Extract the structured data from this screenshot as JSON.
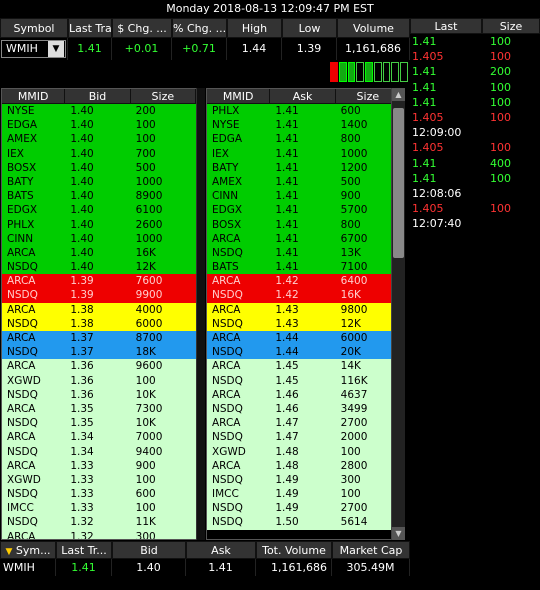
{
  "header": {
    "datetime": "Monday 2018-08-13 12:09:47 PM EST"
  },
  "quote_columns": [
    "Symbol",
    "Last Tra...",
    "$ Chg. ...",
    "% Chg. ...",
    "High",
    "Low",
    "Volume"
  ],
  "quote": {
    "symbol": "WMIH",
    "last": "1.41",
    "chg": "+0.01",
    "pct": "+0.71",
    "high": "1.44",
    "low": "1.39",
    "volume": "1,161,686"
  },
  "meter": [
    "red",
    "green",
    "green",
    "empty",
    "green",
    "empty",
    "empty",
    "empty",
    "empty"
  ],
  "bid_columns": [
    "MMID",
    "Bid",
    "Size"
  ],
  "ask_columns": [
    "MMID",
    "Ask",
    "Size"
  ],
  "bids": [
    [
      "NYSE",
      "1.40",
      "200",
      0
    ],
    [
      "EDGA",
      "1.40",
      "100",
      0
    ],
    [
      "AMEX",
      "1.40",
      "100",
      0
    ],
    [
      "IEX",
      "1.40",
      "700",
      0
    ],
    [
      "BOSX",
      "1.40",
      "500",
      0
    ],
    [
      "BATY",
      "1.40",
      "1000",
      0
    ],
    [
      "BATS",
      "1.40",
      "8900",
      0
    ],
    [
      "EDGX",
      "1.40",
      "6100",
      0
    ],
    [
      "PHLX",
      "1.40",
      "2600",
      0
    ],
    [
      "CINN",
      "1.40",
      "1000",
      0
    ],
    [
      "ARCA",
      "1.40",
      "16K",
      0
    ],
    [
      "NSDQ",
      "1.40",
      "12K",
      0
    ],
    [
      "ARCA",
      "1.39",
      "7600",
      1
    ],
    [
      "NSDQ",
      "1.39",
      "9900",
      1
    ],
    [
      "ARCA",
      "1.38",
      "4000",
      2
    ],
    [
      "NSDQ",
      "1.38",
      "6000",
      2
    ],
    [
      "ARCA",
      "1.37",
      "8700",
      3
    ],
    [
      "NSDQ",
      "1.37",
      "18K",
      3
    ],
    [
      "ARCA",
      "1.36",
      "9600",
      4
    ],
    [
      "XGWD",
      "1.36",
      "100",
      4
    ],
    [
      "NSDQ",
      "1.36",
      "10K",
      4
    ],
    [
      "ARCA",
      "1.35",
      "7300",
      4
    ],
    [
      "NSDQ",
      "1.35",
      "10K",
      4
    ],
    [
      "ARCA",
      "1.34",
      "7000",
      4
    ],
    [
      "NSDQ",
      "1.34",
      "9400",
      4
    ],
    [
      "ARCA",
      "1.33",
      "900",
      4
    ],
    [
      "XGWD",
      "1.33",
      "100",
      4
    ],
    [
      "NSDQ",
      "1.33",
      "600",
      4
    ],
    [
      "IMCC",
      "1.33",
      "100",
      4
    ],
    [
      "NSDQ",
      "1.32",
      "11K",
      4
    ],
    [
      "ARCA",
      "1.32",
      "300",
      4
    ]
  ],
  "asks": [
    [
      "PHLX",
      "1.41",
      "600",
      0
    ],
    [
      "NYSE",
      "1.41",
      "1400",
      0
    ],
    [
      "EDGA",
      "1.41",
      "800",
      0
    ],
    [
      "IEX",
      "1.41",
      "1000",
      0
    ],
    [
      "BATY",
      "1.41",
      "1200",
      0
    ],
    [
      "AMEX",
      "1.41",
      "500",
      0
    ],
    [
      "CINN",
      "1.41",
      "900",
      0
    ],
    [
      "EDGX",
      "1.41",
      "5700",
      0
    ],
    [
      "BOSX",
      "1.41",
      "800",
      0
    ],
    [
      "ARCA",
      "1.41",
      "6700",
      0
    ],
    [
      "NSDQ",
      "1.41",
      "13K",
      0
    ],
    [
      "BATS",
      "1.41",
      "7100",
      0
    ],
    [
      "ARCA",
      "1.42",
      "6400",
      1
    ],
    [
      "NSDQ",
      "1.42",
      "16K",
      1
    ],
    [
      "ARCA",
      "1.43",
      "9800",
      2
    ],
    [
      "NSDQ",
      "1.43",
      "12K",
      2
    ],
    [
      "ARCA",
      "1.44",
      "6000",
      3
    ],
    [
      "NSDQ",
      "1.44",
      "20K",
      3
    ],
    [
      "ARCA",
      "1.45",
      "14K",
      4
    ],
    [
      "NSDQ",
      "1.45",
      "116K",
      4
    ],
    [
      "ARCA",
      "1.46",
      "4637",
      4
    ],
    [
      "NSDQ",
      "1.46",
      "3499",
      4
    ],
    [
      "ARCA",
      "1.47",
      "2700",
      4
    ],
    [
      "NSDQ",
      "1.47",
      "2000",
      4
    ],
    [
      "XGWD",
      "1.48",
      "100",
      4
    ],
    [
      "ARCA",
      "1.48",
      "2800",
      4
    ],
    [
      "NSDQ",
      "1.49",
      "300",
      4
    ],
    [
      "IMCC",
      "1.49",
      "100",
      4
    ],
    [
      "NSDQ",
      "1.49",
      "2700",
      4
    ],
    [
      "NSDQ",
      "1.50",
      "5614",
      4
    ]
  ],
  "ts_columns": [
    "Last",
    "Size"
  ],
  "time_sales": [
    {
      "p": "1.41",
      "s": "100",
      "c": "g"
    },
    {
      "p": "1.405",
      "s": "100",
      "c": "r"
    },
    {
      "p": "1.41",
      "s": "200",
      "c": "g"
    },
    {
      "p": "1.41",
      "s": "100",
      "c": "g"
    },
    {
      "p": "1.41",
      "s": "100",
      "c": "g"
    },
    {
      "p": "1.405",
      "s": "100",
      "c": "r"
    },
    {
      "t": "12:09:00"
    },
    {
      "p": "1.405",
      "s": "100",
      "c": "r"
    },
    {
      "p": "1.41",
      "s": "400",
      "c": "g"
    },
    {
      "p": "1.41",
      "s": "100",
      "c": "g"
    },
    {
      "t": "12:08:06"
    },
    {
      "p": "1.405",
      "s": "100",
      "c": "r"
    },
    {
      "t": "12:07:40"
    }
  ],
  "footer_columns": [
    "Sym...",
    "Last Tr...",
    "Bid",
    "Ask",
    "Tot. Volume",
    "Market Cap"
  ],
  "footer": {
    "sym": "WMIH",
    "last": "1.41",
    "bid": "1.40",
    "ask": "1.41",
    "vol": "1,161,686",
    "cap": "305.49M"
  }
}
